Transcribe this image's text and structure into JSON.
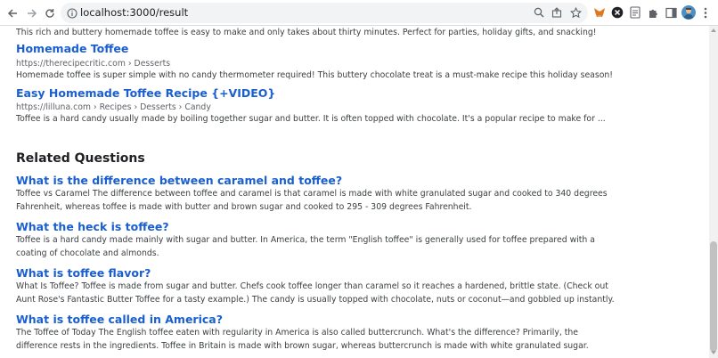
{
  "browser": {
    "url": "localhost:3000/result",
    "icons": [
      "back-arrow-icon",
      "forward-arrow-icon",
      "reload-icon",
      "site-info-icon",
      "zoom-icon",
      "share-icon",
      "bookmark-star-icon",
      "metamask-fox-icon",
      "x-extension-icon",
      "document-extension-icon",
      "puzzle-extensions-icon",
      "side-panel-icon",
      "profile-avatar-icon",
      "menu-dots-icon"
    ]
  },
  "results": {
    "top_snippet": "This rich and buttery homemade toffee is easy to make and only takes about thirty minutes. Perfect for parties, holiday gifts, and snacking!",
    "items": [
      {
        "title": "Homemade Toffee",
        "url": "https://therecipecritic.com › Desserts",
        "description": "Homemade toffee is super simple with no candy thermometer required! This buttery chocolate treat is a must-make recipe this holiday season!"
      },
      {
        "title": "Easy Homemade Toffee Recipe {+VIDEO}",
        "url": "https://lilluna.com › Recipes › Desserts › Candy",
        "description": "Toffee is a hard candy usually made by boiling together sugar and butter. It is often topped with chocolate. It's a popular recipe to make for ..."
      }
    ]
  },
  "related": {
    "heading": "Related Questions",
    "questions": [
      {
        "question": "What is the difference between caramel and toffee?",
        "answer": "Toffee vs Caramel The difference between toffee and caramel is that caramel is made with white granulated sugar and cooked to 340 degrees Fahrenheit, whereas toffee is made with butter and brown sugar and cooked to 295 - 309 degrees Fahrenheit."
      },
      {
        "question": "What the heck is toffee?",
        "answer": "Toffee is a hard candy made mainly with sugar and butter. In America, the term \"English toffee\" is generally used for toffee prepared with a coating of chocolate and almonds."
      },
      {
        "question": "What is toffee flavor?",
        "answer": "What Is Toffee? Toffee is made from sugar and butter. Chefs cook toffee longer than caramel so it reaches a hardened, brittle state. (Check out Aunt Rose's Fantastic Butter Toffee for a tasty example.) The candy is usually topped with chocolate, nuts or coconut—and gobbled up instantly."
      },
      {
        "question": "What is toffee called in America?",
        "answer": "The Toffee of Today The English toffee eaten with regularity in America is also called buttercrunch. What's the difference? Primarily, the difference rests in the ingredients. Toffee in Britain is made with brown sugar, whereas buttercrunch is made with white granulated sugar."
      }
    ]
  },
  "colors": {
    "link": "#1a5fd0",
    "body_text": "#3c4043",
    "url_text": "#5f6368"
  }
}
